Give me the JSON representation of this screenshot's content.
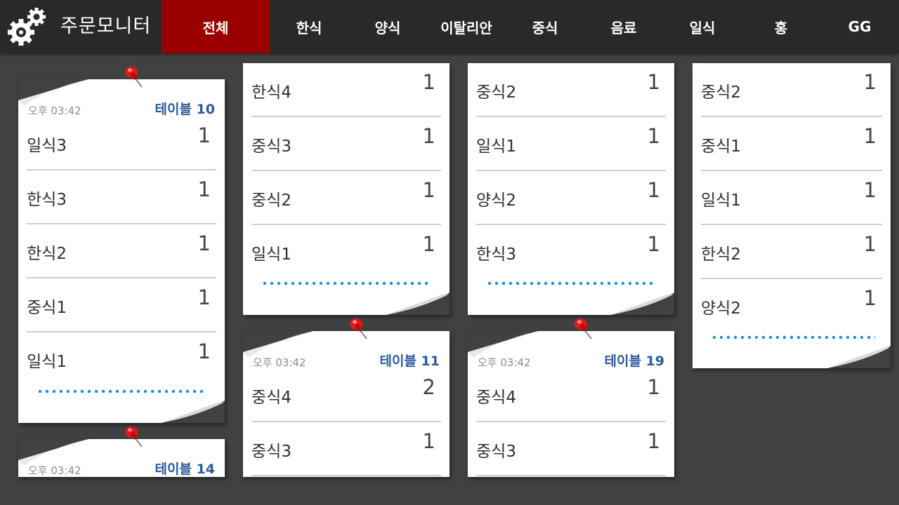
{
  "app": {
    "title": "주문모니터",
    "logo_icon": "gears-icon"
  },
  "tabs": [
    {
      "label": "전체",
      "active": true
    },
    {
      "label": "한식",
      "active": false
    },
    {
      "label": "양식",
      "active": false
    },
    {
      "label": "이탈리안",
      "active": false
    },
    {
      "label": "중식",
      "active": false
    },
    {
      "label": "음료",
      "active": false
    },
    {
      "label": "일식",
      "active": false
    },
    {
      "label": "홍",
      "active": false
    },
    {
      "label": "GG",
      "active": false
    }
  ],
  "colors": {
    "background": "#414141",
    "topbar": "#292929",
    "active_tab": "#9a0000",
    "table_label": "#2c5a9a",
    "dots": "#1a8fdc"
  },
  "orders": [
    {
      "time": "오후 03:42",
      "table": "테이블 10",
      "items": [
        {
          "name": "일식3",
          "qty": "1"
        },
        {
          "name": "한식3",
          "qty": "1"
        },
        {
          "name": "한식2",
          "qty": "1"
        },
        {
          "name": "중식1",
          "qty": "1"
        },
        {
          "name": "일식1",
          "qty": "1"
        }
      ]
    },
    {
      "time": "오후 03:42",
      "table": "테이블 14",
      "items": []
    },
    {
      "time": "",
      "table": "",
      "items": [
        {
          "name": "한식4",
          "qty": "1"
        },
        {
          "name": "중식3",
          "qty": "1"
        },
        {
          "name": "중식2",
          "qty": "1"
        },
        {
          "name": "일식1",
          "qty": "1"
        }
      ]
    },
    {
      "time": "오후 03:42",
      "table": "테이블 11",
      "items": [
        {
          "name": "중식4",
          "qty": "2"
        },
        {
          "name": "중식3",
          "qty": "1"
        }
      ]
    },
    {
      "time": "",
      "table": "",
      "items": [
        {
          "name": "중식2",
          "qty": "1"
        },
        {
          "name": "일식1",
          "qty": "1"
        },
        {
          "name": "양식2",
          "qty": "1"
        },
        {
          "name": "한식3",
          "qty": "1"
        }
      ]
    },
    {
      "time": "오후 03:42",
      "table": "테이블 19",
      "items": [
        {
          "name": "중식4",
          "qty": "1"
        },
        {
          "name": "중식3",
          "qty": "1"
        }
      ]
    },
    {
      "time": "",
      "table": "",
      "items": [
        {
          "name": "중식2",
          "qty": "1"
        },
        {
          "name": "중식1",
          "qty": "1"
        },
        {
          "name": "일식1",
          "qty": "1"
        },
        {
          "name": "한식2",
          "qty": "1"
        },
        {
          "name": "양식2",
          "qty": "1"
        }
      ]
    }
  ]
}
